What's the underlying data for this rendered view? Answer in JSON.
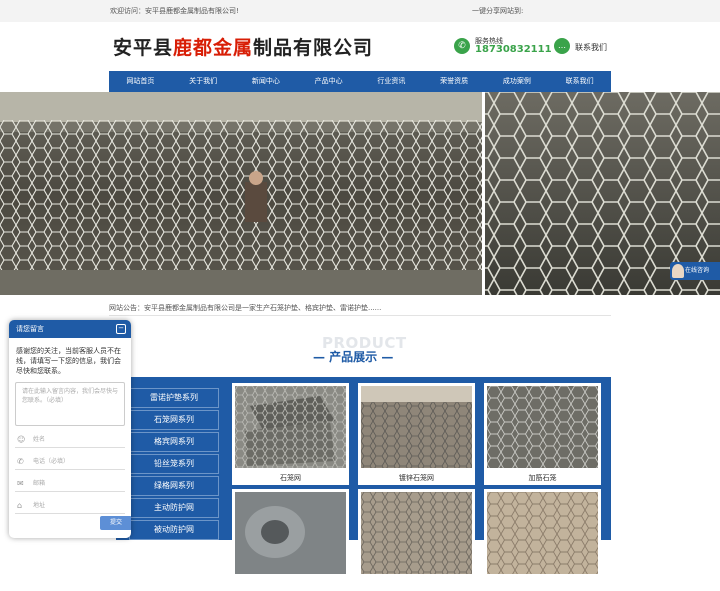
{
  "topbar": {
    "welcome": "欢迎访问：安平县鹿都金属制品有限公司!",
    "share": "一键分享网站到:"
  },
  "header": {
    "company_prefix": "安平县",
    "company_brand": "鹿都金属",
    "company_suffix": "制品有限公司",
    "hotline_label": "服务热线",
    "hotline_number": "18730832111",
    "contact_label": "联系我们"
  },
  "nav": {
    "items": [
      "网站首页",
      "关于我们",
      "新闻中心",
      "产品中心",
      "行业资讯",
      "荣誉资质",
      "成功案例",
      "联系我们"
    ]
  },
  "banner": {
    "active_slide": 1,
    "slide_count": 5
  },
  "float_chat": {
    "label": "在线咨询"
  },
  "notice": {
    "text": "网站公告：安平县鹿都金属制品有限公司是一家生产石笼护垫、格宾护垫、雷诺护垫......"
  },
  "section": {
    "bg_title": "PRODUCT",
    "title": "— 产品展示 —"
  },
  "categories": [
    "雷诺护垫系列",
    "石笼网系列",
    "格宾网系列",
    "铅丝笼系列",
    "绿格网系列",
    "主动防护网",
    "被动防护网"
  ],
  "products": [
    {
      "caption": "石笼网"
    },
    {
      "caption": "镀锌石笼网"
    },
    {
      "caption": "加筋石笼"
    },
    {
      "caption": ""
    },
    {
      "caption": ""
    },
    {
      "caption": ""
    }
  ],
  "message_panel": {
    "title": "请您留言",
    "intro": "感谢您的关注，当前客服人员不在线，请填写一下您的信息，我们会尽快和您联系。",
    "textarea_placeholder": "请在此输入留言内容，我们会尽快与您联系。（必填）",
    "name_placeholder": "姓名",
    "phone_placeholder": "电话（必填）",
    "email_placeholder": "邮箱",
    "address_placeholder": "地址",
    "submit_label": "提交"
  },
  "colors": {
    "nav_blue": "#1f5ba6",
    "brand_red": "#d81e06",
    "hotline_green": "#3aa34a"
  }
}
